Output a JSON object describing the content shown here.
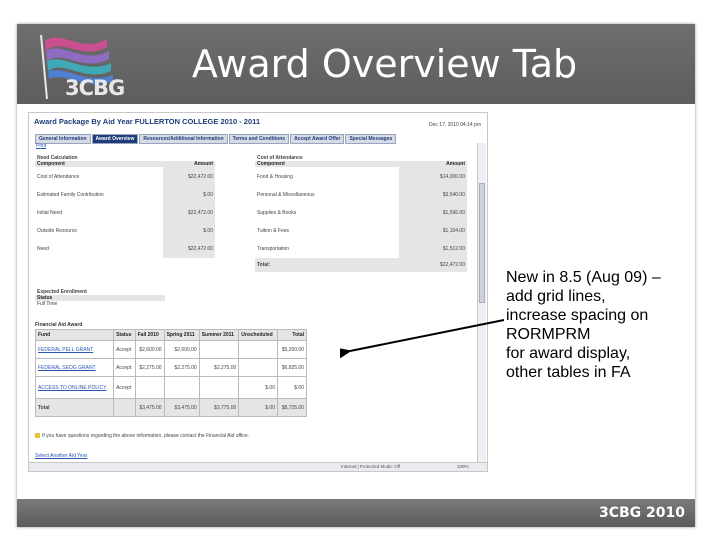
{
  "slide": {
    "title": "Award Overview Tab",
    "logo_text": "3CBG",
    "footer": "3CBG 2010"
  },
  "screenshot": {
    "page_title": "Award Package By Aid Year FULLERTON COLLEGE 2010 - 2011",
    "date": "Dec 17, 2010 04:14 pm",
    "tabs": [
      "General Information",
      "Award Overview",
      "Resources/Additional Information",
      "Terms and Conditions",
      "Accept Award Offer",
      "Special Messages"
    ],
    "active_tab": 1,
    "print_link": "Print",
    "need_calc": {
      "header1": "Need Calculation",
      "header2": "Component",
      "amount_header": "Amount",
      "rows": [
        {
          "label": "Cost of Attendance",
          "amount": "$22,472.00"
        },
        {
          "label": "Estimated Family Contribution",
          "amount": "$.00"
        },
        {
          "label": "Initial Need",
          "amount": "$22,472.00"
        },
        {
          "label": "Outside Resource",
          "amount": "$.00"
        },
        {
          "label": "Need",
          "amount": "$22,472.00"
        }
      ]
    },
    "coa": {
      "header1": "Cost of Attendance",
      "header2": "Component",
      "amount_header": "Amount",
      "rows": [
        {
          "label": "Food & Housing",
          "amount": "$14,000.00"
        },
        {
          "label": "Personal & Miscellaneous",
          "amount": "$3,540.00"
        },
        {
          "label": "Supplies & Books",
          "amount": "$1,596.00"
        },
        {
          "label": "Tuition & Fees",
          "amount": "$1,104.00"
        },
        {
          "label": "Transportation",
          "amount": "$1,512.00"
        }
      ],
      "total_label": "Total:",
      "total_amount": "$22,472.00"
    },
    "enrollment": {
      "header": "Expected Enrollment",
      "status_label": "Status",
      "status_value": "Full Time"
    },
    "aid": {
      "header": "Financial Aid Award",
      "columns": [
        "Fund",
        "Status",
        "Fall 2010",
        "Spring 2011",
        "Summer 2011",
        "Unscheduled",
        "Total"
      ],
      "rows": [
        {
          "fund": "FEDERAL PELL GRANT",
          "status": "Accept",
          "fall": "$2,600.00",
          "spring": "$2,600.00",
          "summer": "",
          "unsched": "",
          "total": "$5,200.00"
        },
        {
          "fund": "FEDERAL SEOG GRANT",
          "status": "Accept",
          "fall": "$2,275.00",
          "spring": "$2,275.00",
          "summer": "$2,275.00",
          "unsched": "",
          "total": "$6,825.00"
        },
        {
          "fund": "ACCESS TO ONLINE POLICY",
          "status": "Accept",
          "fall": "",
          "spring": "",
          "summer": "",
          "unsched": "$.00",
          "total": "$.00"
        }
      ],
      "total_row": {
        "label": "Total",
        "fall": "$3,475.00",
        "spring": "$3,475.00",
        "summer": "$3,775.00",
        "unsched": "$.00",
        "total": "$8,725.00"
      }
    },
    "note": "If you have questions regarding the above information, please contact the Financial Aid office.",
    "select_another": "Select Another Aid Year",
    "status_bar_zone": "Internet | Protected Mode: Off",
    "status_bar_zoom": "100%"
  },
  "callout": {
    "lines": [
      "New in 8.5 (Aug 09) –",
      "add grid lines,",
      "increase spacing on",
      "RORMPRM",
      "for award display,",
      "other tables in FA"
    ]
  }
}
